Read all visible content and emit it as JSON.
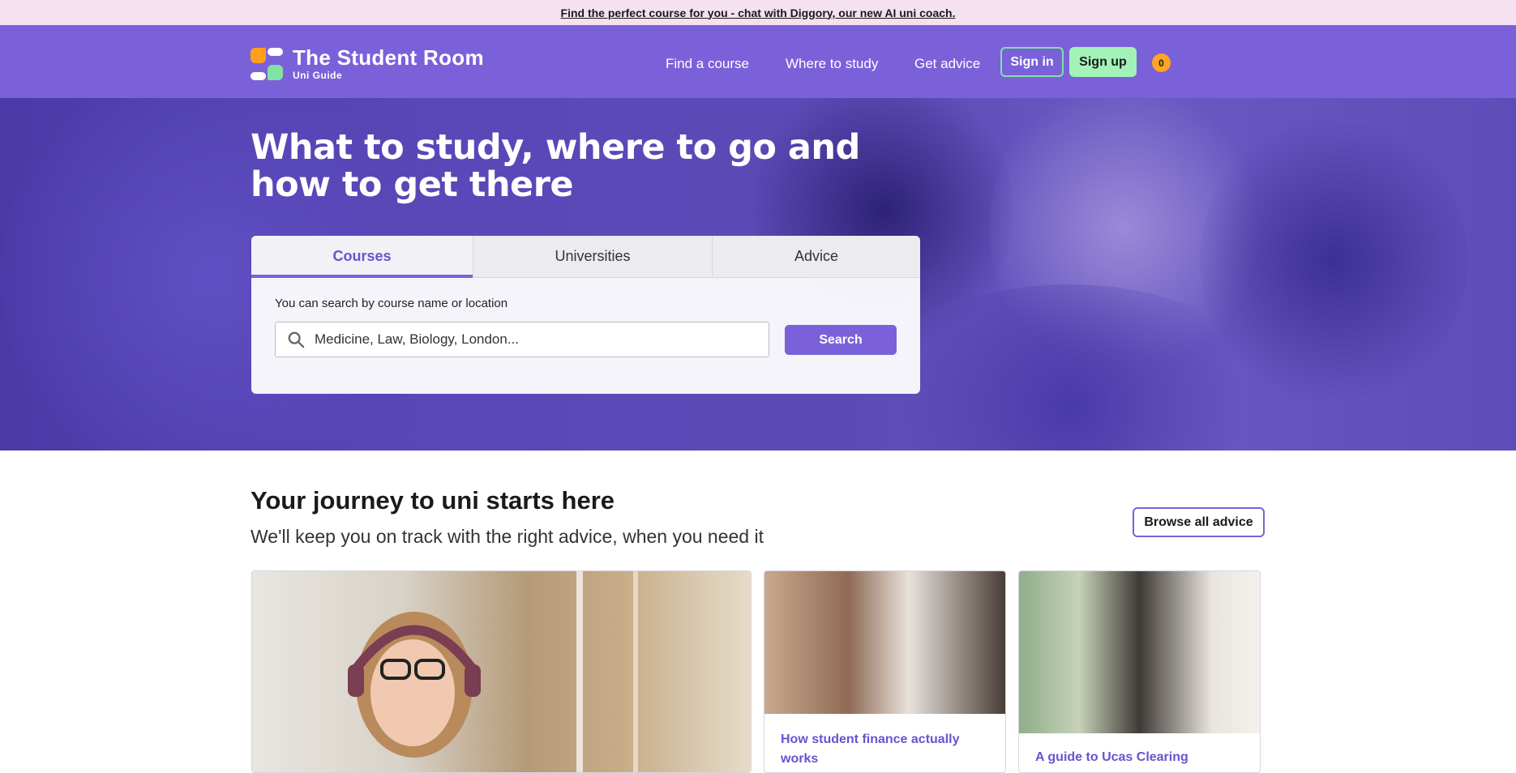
{
  "promo": {
    "text": "Find the perfect course for you - chat with Diggory, our new AI uni coach."
  },
  "header": {
    "brand_title": "The Student Room",
    "brand_subtitle": "Uni Guide",
    "nav": [
      "Find a course",
      "Where to study",
      "Get advice"
    ],
    "sign_in": "Sign in",
    "sign_up": "Sign up",
    "notification_count": "0"
  },
  "hero": {
    "title": "What to study, where to go and how to get there",
    "tabs": [
      "Courses",
      "Universities",
      "Advice"
    ],
    "active_tab": "Courses",
    "search_label": "You can search by course name or location",
    "search_placeholder": "Medicine, Law, Biology, London...",
    "search_button": "Search"
  },
  "journey": {
    "title": "Your journey to uni starts here",
    "subtitle": "We'll keep you on track with the right advice, when you need it",
    "browse_button": "Browse all advice",
    "cards": [
      {
        "title": ""
      },
      {
        "title": "How student finance actually works"
      },
      {
        "title": "A guide to Ucas Clearing"
      }
    ]
  },
  "colors": {
    "brand_purple": "#7b61d9",
    "promo_bg": "#f5e1ef",
    "accent_green": "#a3f2b8",
    "badge_orange": "#ffa51f"
  }
}
